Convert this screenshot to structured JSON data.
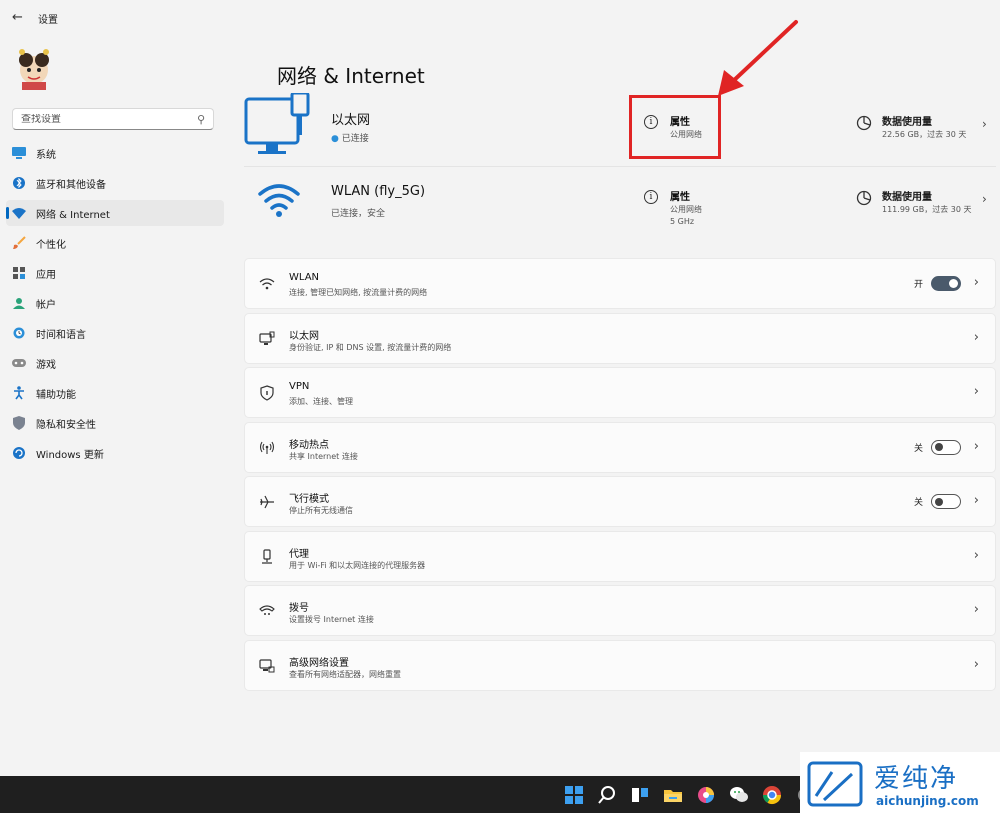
{
  "window": {
    "title": "设置"
  },
  "sidebar": {
    "search_placeholder": "查找设置",
    "items": [
      {
        "label": "系统",
        "icon": "monitor-icon"
      },
      {
        "label": "蓝牙和其他设备",
        "icon": "bluetooth-icon"
      },
      {
        "label": "网络 & Internet",
        "icon": "wifi-icon",
        "active": true
      },
      {
        "label": "个性化",
        "icon": "brush-icon"
      },
      {
        "label": "应用",
        "icon": "apps-icon"
      },
      {
        "label": "帐户",
        "icon": "user-icon"
      },
      {
        "label": "时间和语言",
        "icon": "globe-clock-icon"
      },
      {
        "label": "游戏",
        "icon": "gamepad-icon"
      },
      {
        "label": "辅助功能",
        "icon": "accessibility-icon"
      },
      {
        "label": "隐私和安全性",
        "icon": "shield-icon"
      },
      {
        "label": "Windows 更新",
        "icon": "update-icon"
      }
    ]
  },
  "main": {
    "title": "网络 & Internet",
    "connections": [
      {
        "name": "以太网",
        "status": "已连接",
        "properties_label": "属性",
        "properties_sub": [
          "公用网络"
        ],
        "usage_label": "数据使用量",
        "usage_value": "22.56 GB，过去 30 天"
      },
      {
        "name": "WLAN (fly_5G)",
        "status": "已连接，安全",
        "properties_label": "属性",
        "properties_sub": [
          "公用网络",
          "5 GHz"
        ],
        "usage_label": "数据使用量",
        "usage_value": "111.99 GB，过去 30 天"
      }
    ],
    "settings": [
      {
        "title": "WLAN",
        "desc": "连接, 管理已知网络, 按流量计费的网络",
        "toggle": "on",
        "toggle_label": "开",
        "icon": "wifi-icon"
      },
      {
        "title": "以太网",
        "desc": "身份验证, IP 和 DNS 设置, 按流量计费的网络",
        "icon": "ethernet-icon"
      },
      {
        "title": "VPN",
        "desc": "添加、连接、管理",
        "icon": "shield-icon"
      },
      {
        "title": "移动热点",
        "desc": "共享 Internet 连接",
        "toggle": "off",
        "toggle_label": "关",
        "icon": "hotspot-icon"
      },
      {
        "title": "飞行模式",
        "desc": "停止所有无线通信",
        "toggle": "off",
        "toggle_label": "关",
        "icon": "airplane-icon"
      },
      {
        "title": "代理",
        "desc": "用于 Wi-Fi 和以太网连接的代理服务器",
        "icon": "proxy-icon"
      },
      {
        "title": "拨号",
        "desc": "设置拨号 Internet 连接",
        "icon": "dialup-icon"
      },
      {
        "title": "高级网络设置",
        "desc": "查看所有网络适配器，网络重置",
        "icon": "advanced-network-icon"
      }
    ]
  },
  "watermark": {
    "brand": "爱纯净",
    "url": "aichunjing.com"
  },
  "colors": {
    "accent": "#0067c0",
    "highlight": "#e02424",
    "taskbar": "#1f1f1f"
  }
}
